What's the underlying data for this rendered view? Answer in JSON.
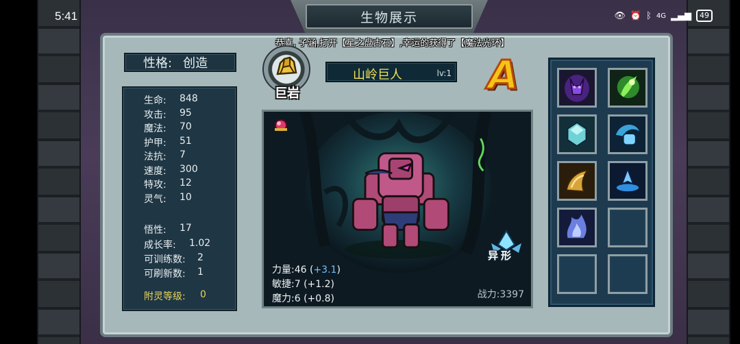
{
  "status_bar": {
    "time": "5:41",
    "network_label": "4G",
    "battery": "49"
  },
  "title": "生物展示",
  "notice": "恭喜, 子涵,打开【星之盘古石】,幸运的获得了【魔法光环】",
  "trait": {
    "label": "性格:",
    "value": "创造"
  },
  "stats": [
    {
      "key": "生命:",
      "value": "848"
    },
    {
      "key": "攻击:",
      "value": "95"
    },
    {
      "key": "魔法:",
      "value": "70"
    },
    {
      "key": "护甲:",
      "value": "51"
    },
    {
      "key": "法抗:",
      "value": "7"
    },
    {
      "key": "速度:",
      "value": "300"
    },
    {
      "key": "特攻:",
      "value": "12"
    },
    {
      "key": "灵气:",
      "value": "10"
    }
  ],
  "extra_stats": [
    {
      "key": "悟性:",
      "value": "17"
    },
    {
      "key": "成长率:",
      "value": "1.02"
    },
    {
      "key": "可训练数:",
      "value": "2"
    },
    {
      "key": "可刷新数:",
      "value": "1"
    }
  ],
  "spirit_level": {
    "key": "附灵等级:",
    "value": "0"
  },
  "element_badge": {
    "label": "巨岩",
    "icon": "rock-icon"
  },
  "creature": {
    "name": "山岭巨人",
    "level": "lv:1",
    "grade": "A"
  },
  "attributes": {
    "strength": {
      "label": "力量:46",
      "bonus": "+3.1"
    },
    "agility": "敏捷:7 (+1.2)",
    "magic": "魔力:6 (+0.8)"
  },
  "power": "战力:3397",
  "special_tag": "异形",
  "skills": [
    {
      "icon": "shadow-demon-icon",
      "color": "#7a3fd1"
    },
    {
      "icon": "green-aura-icon",
      "color": "#5fd13a"
    },
    {
      "icon": "crystal-shield-icon",
      "color": "#5bc4c9"
    },
    {
      "icon": "water-fist-icon",
      "color": "#3aa3d8"
    },
    {
      "icon": "golden-horn-icon",
      "color": "#d8a33a"
    },
    {
      "icon": "blue-spire-icon",
      "color": "#2f8ee0"
    },
    {
      "icon": "blue-flame-icon",
      "color": "#6a7fe0"
    },
    {
      "icon": "empty",
      "color": ""
    },
    {
      "icon": "empty",
      "color": ""
    },
    {
      "icon": "empty",
      "color": ""
    }
  ],
  "colors": {
    "panel": "#a7b8bb",
    "dark_box": "#1f3644",
    "gold_text": "#e8d55a",
    "name_text": "#f1e25a",
    "grade": "#f6c318"
  }
}
